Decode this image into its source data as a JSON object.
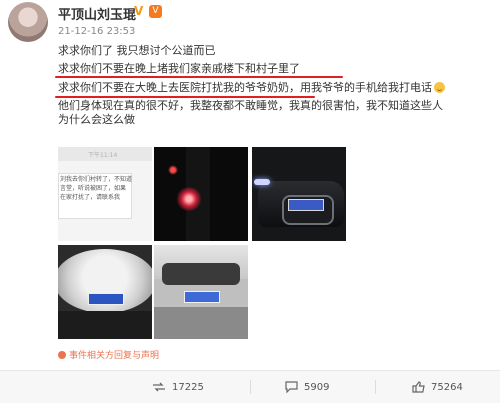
{
  "user": {
    "name": "平顶山刘玉琨",
    "timestamp": "21-12-16 23:53",
    "verify_icon": "v-badge-icon",
    "member_icon": "vip-icon"
  },
  "post": {
    "line1": "求求你们了 我只想讨个公道而已",
    "line2": "求求你们不要在晚上堵我们家亲戚楼下和村子里了",
    "line3_a": "求求你们不要在大晚上去医院打扰我的爷爷奶奶",
    "line3_b": "，用我爷爷的手机给我打电话",
    "line4": "他们身体现在真的很不好，我整夜都不敢睡觉，我真的很害怕，我不知道这些人",
    "line5": "为什么会这么做"
  },
  "photos": {
    "p1_time": "下午11:14",
    "p1_chat": "刘我去你们村转了，不知道\n言堂，听说被困了，如果\n在家打扰了，请联系我"
  },
  "source_text": "事件相关方回复与声明",
  "actions": {
    "repost_count": "17225",
    "comment_count": "5909",
    "like_count": "75264"
  },
  "colors": {
    "underline": "#e02020",
    "link": "#eb7350"
  }
}
